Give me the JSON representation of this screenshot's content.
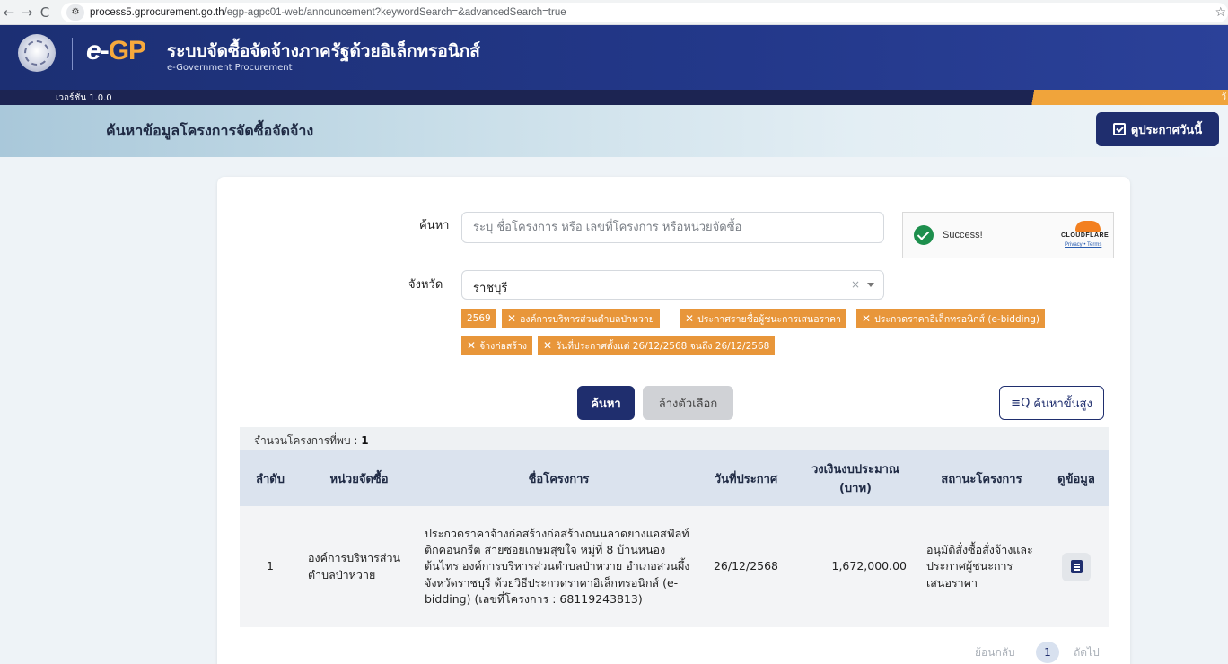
{
  "browser": {
    "url_host": "process5.gprocurement.go.th",
    "url_path": "/egp-agpc01-web/announcement?keywordSearch=&advancedSearch=true"
  },
  "header": {
    "logo_e": "e",
    "logo_dash": "-",
    "logo_gp": "GP",
    "title": "ระบบจัดซื้อจัดจ้างภาครัฐด้วยอิเล็กทรอนิกส์",
    "subtitle": "e-Government Procurement",
    "version": "เวอร์ชั่น 1.0.0",
    "right_text": "วั"
  },
  "title_bar": {
    "page_title": "ค้นหาข้อมูลโครงการจัดซื้อจัดจ้าง",
    "today_button": "ดูประกาศวันนี้"
  },
  "search": {
    "keyword_label": "ค้นหา",
    "keyword_placeholder": "ระบุ ชื่อโครงการ หรือ เลขที่โครงการ หรือหน่วยจัดซื้อ",
    "province_label": "จังหวัด",
    "province_value": "ราชบุรี",
    "clear_symbol": "×"
  },
  "captcha": {
    "status": "Success!",
    "brand": "CLOUDFLARE",
    "links": "Privacy • Terms"
  },
  "filters": [
    {
      "x": false,
      "label": "2569"
    },
    {
      "x": true,
      "label": "องค์การบริหารส่วนตำบลป่าหวาย"
    },
    {
      "x": true,
      "label": "ประกาศรายชื่อผู้ชนะการเสนอราคา"
    },
    {
      "x": true,
      "label": "ประกวดราคาอิเล็กทรอนิกส์ (e-bidding)"
    },
    {
      "x": true,
      "label": "จ้างก่อสร้าง"
    },
    {
      "x": true,
      "label": "วันที่ประกาศตั้งแต่ 26/12/2568 จนถึง 26/12/2568"
    }
  ],
  "buttons": {
    "search": "ค้นหา",
    "clear": "ล้างตัวเลือก",
    "advanced": "ค้นหาขั้นสูง",
    "advanced_icon": "≡Q"
  },
  "results": {
    "count_label": "จำนวนโครงการที่พบ : ",
    "count": "1",
    "headers": [
      "ลำดับ",
      "หน่วยจัดซื้อ",
      "ชื่อโครงการ",
      "วันที่ประกาศ",
      "วงเงินงบประมาณ (บาท)",
      "สถานะโครงการ",
      "ดูข้อมูล"
    ],
    "rows": [
      {
        "no": "1",
        "agency": "องค์การบริหารส่วนตำบลป่าหวาย",
        "project": "ประกวดราคาจ้างก่อสร้างก่อสร้างถนนลาดยางแอสฟัลท์ติกคอนกรีต สายซอยเกษมสุขใจ หมู่ที่ 8 บ้านหนองต้นไทร องค์การบริหารส่วนตำบลป่าหวาย อำเภอสวนผึ้ง จังหวัดราชบุรี ด้วยวิธีประกวดราคาอิเล็กทรอนิกส์ (e-bidding) (เลขที่โครงการ : 68119243813)",
        "date": "26/12/2568",
        "budget": "1,672,000.00",
        "status": "อนุมัติสั่งซื้อสั่งจ้างและประกาศผู้ชนะการเสนอราคา"
      }
    ]
  },
  "pagination": {
    "prev": "ย้อนกลับ",
    "current": "1",
    "next": "ถัดไป"
  },
  "colors": {
    "primary": "#1f2e6e",
    "chip": "#e8963a",
    "header": "#23388a"
  }
}
